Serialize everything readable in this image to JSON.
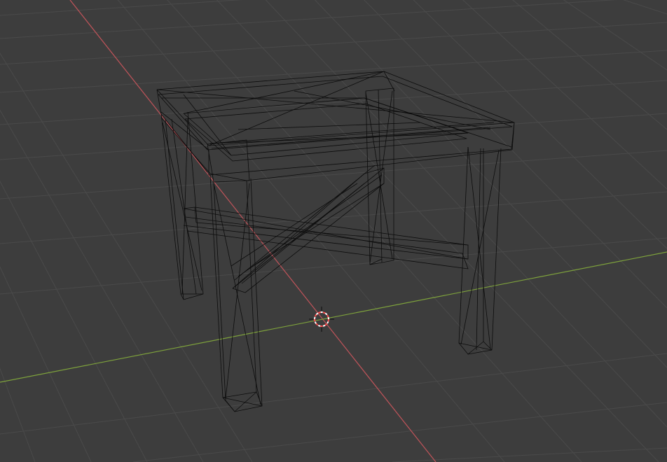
{
  "viewport": {
    "background_color": "#3d3d3d",
    "grid_color": "#4a4a4a",
    "x_axis_color": "#c0545a",
    "y_axis_color": "#7ea23c",
    "wire_color": "#0c0c0c",
    "cursor_colors": [
      "#ff4d4d",
      "#ffffff"
    ]
  },
  "objects": [
    {
      "name": "table",
      "display": "wireframe"
    }
  ],
  "icons": {
    "cursor": "3d-cursor-icon"
  }
}
